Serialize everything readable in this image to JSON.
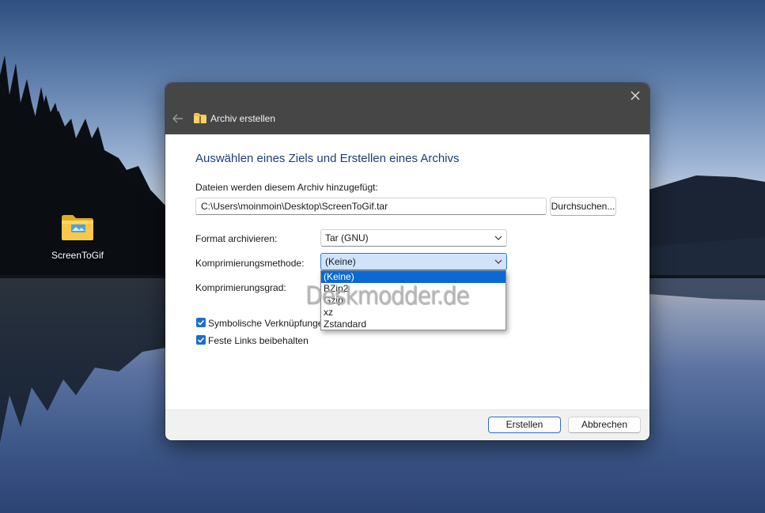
{
  "desktop": {
    "icon_label": "ScreenToGif"
  },
  "dialog": {
    "title": "Archiv erstellen",
    "heading": "Auswählen eines Ziels und Erstellen eines Archivs",
    "files_label": "Dateien werden diesem Archiv hinzugefügt:",
    "path_value": "C:\\Users\\moinmoin\\Desktop\\ScreenToGif.tar",
    "browse_label": "Durchsuchen...",
    "format_label": "Format archivieren:",
    "format_value": "Tar (GNU)",
    "method_label": "Komprimierungsmethode:",
    "method_value": "(Keine)",
    "method_options": [
      "(Keine)",
      "BZip2",
      "Gzip",
      "xz",
      "Zstandard"
    ],
    "level_label": "Komprimierungsgrad:",
    "symlinks_label": "Symbolische Verknüpfungen beibehalten",
    "symlinks_checked": true,
    "hardlinks_label": "Feste Links beibehalten",
    "hardlinks_checked": true,
    "create_label": "Erstellen",
    "cancel_label": "Abbrechen"
  },
  "watermark": "Deskmodder.de",
  "colors": {
    "titlebar": "#464646",
    "heading": "#1b3f78",
    "accent": "#0b69d4",
    "checkbox": "#1c6fc9"
  }
}
